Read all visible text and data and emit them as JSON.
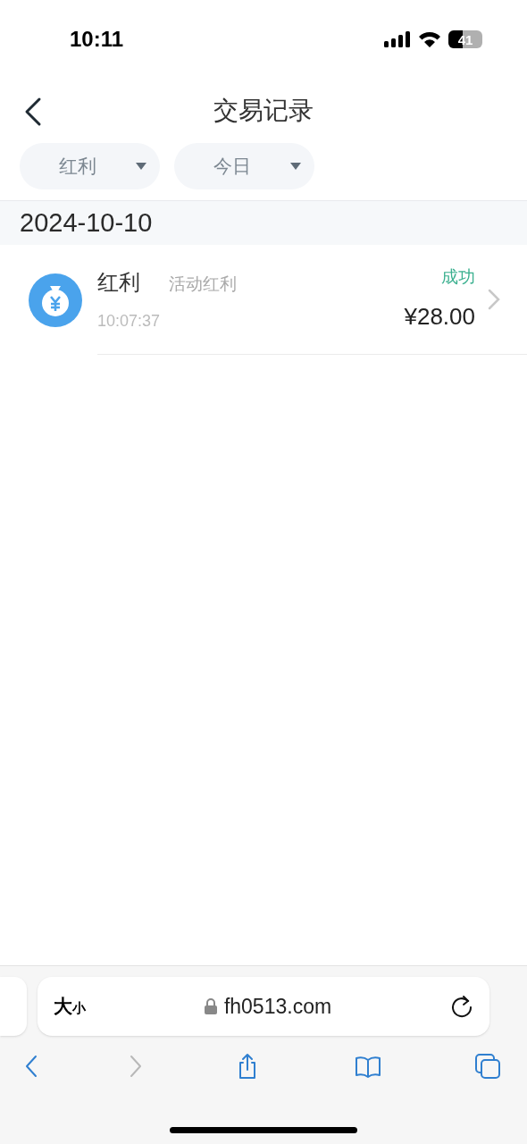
{
  "status_bar": {
    "time": "10:11",
    "battery": "41"
  },
  "header": {
    "title": "交易记录"
  },
  "filters": [
    {
      "label": "红利"
    },
    {
      "label": "今日"
    }
  ],
  "groups": [
    {
      "date": "2024-10-10",
      "records": [
        {
          "name": "红利",
          "type": "活动红利",
          "time": "10:07:37",
          "status": "成功",
          "amount": "¥28.00"
        }
      ]
    }
  ],
  "browser": {
    "text_size": {
      "big": "大",
      "small": "小"
    },
    "url": "fh0513.com",
    "toolbar": [
      {
        "kind": "back",
        "disabled": false
      },
      {
        "kind": "forward",
        "disabled": true
      },
      {
        "kind": "share",
        "disabled": false
      },
      {
        "kind": "bookmarks",
        "disabled": false
      },
      {
        "kind": "tabs",
        "disabled": false
      }
    ]
  }
}
